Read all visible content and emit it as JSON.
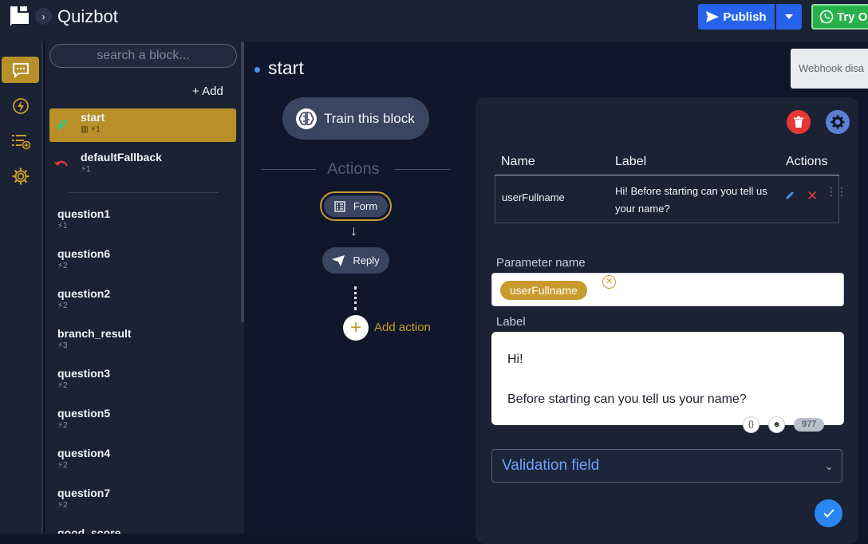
{
  "topbar": {
    "app_title": "Quizbot",
    "publish_label": "Publish",
    "try_label": "Try O",
    "logo_icon": "quizbot-logo-icon",
    "colors": {
      "publish": "#2563eb",
      "try": "#27b14b"
    }
  },
  "rail": {
    "items": [
      {
        "name": "chat-icon",
        "active": true
      },
      {
        "name": "lightning-icon",
        "active": false
      },
      {
        "name": "list-add-icon",
        "active": false
      },
      {
        "name": "gear-icon",
        "active": false
      }
    ],
    "accent": "#b8902a"
  },
  "blocks_panel": {
    "search_placeholder": "search a block...",
    "add_label": "+ Add",
    "blocks": [
      {
        "name": "start",
        "meta": "▥ ⚡1",
        "icon": "rocket-icon",
        "active": true
      },
      {
        "name": "defaultFallback",
        "meta": "⚡1",
        "icon": "undo-icon",
        "active": false
      },
      {
        "name": "question1",
        "meta": "⚡1"
      },
      {
        "name": "question6",
        "meta": "⚡2"
      },
      {
        "name": "question2",
        "meta": "⚡2"
      },
      {
        "name": "branch_result",
        "meta": "⚡3"
      },
      {
        "name": "question3",
        "meta": "⚡2"
      },
      {
        "name": "question5",
        "meta": "⚡2"
      },
      {
        "name": "question4",
        "meta": "⚡2"
      },
      {
        "name": "question7",
        "meta": "⚡2"
      },
      {
        "name": "good_score",
        "meta": ""
      }
    ]
  },
  "main": {
    "block_title": "start",
    "webhook_toast": "Webhook disa",
    "train_label": "Train this block",
    "actions_label": "Actions",
    "flow": {
      "form_label": "Form",
      "reply_label": "Reply",
      "add_action_label": "Add action"
    }
  },
  "form_panel": {
    "table": {
      "headers": [
        "Name",
        "Label",
        "Actions"
      ],
      "rows": [
        {
          "name": "userFullname",
          "label": "Hi! Before starting can you tell us your name?"
        }
      ]
    },
    "parameter_label": "Parameter name",
    "parameter_chip": "userFullname",
    "label_label": "Label",
    "label_text_line1": "Hi!",
    "label_text_line2": "Before starting can you tell us your name?",
    "char_count": "977",
    "validation_placeholder": "Validation field"
  }
}
